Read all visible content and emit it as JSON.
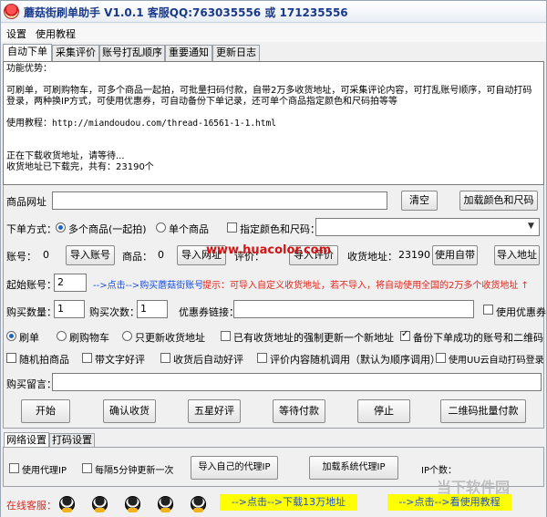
{
  "window": {
    "title": "蘑菇街刷单助手 V1.0.1 客服QQ:763035556 或 171235556"
  },
  "menu": [
    "设置",
    "使用教程"
  ],
  "tabs": [
    "自动下单",
    "采集评价",
    "账号打乱顺序",
    "重要通知",
    "更新日志"
  ],
  "log": {
    "line1": "功能优势：",
    "line2": "可刷单，可刷购物车，可多个商品一起拍，可批量扫码付款，自带2万多收货地址，可采集评论内容，可打乱账号顺序，可自动打码登录，两种换IP方式，可使用优惠券，可自动备份下单记录，还可单个商品指定颜色和尺码拍等等",
    "line3_label": "使用教程：",
    "line3_url": "http://miandoudou.com/thread-16561-1-1.html",
    "line4": "正在下载收货地址，请等待...",
    "line5": "收货地址已下载完，共有：23190个"
  },
  "product": {
    "label": "商品网址",
    "value": "",
    "clear_btn": "清空",
    "add_color_btn": "加载颜色和尺码"
  },
  "order_mode": {
    "label": "下单方式：",
    "options": [
      "多个商品(一起拍)",
      "单个商品"
    ],
    "selected": 0,
    "spec_label": "指定颜色和尺码：",
    "spec_value": ""
  },
  "counts": {
    "account_label": "账号：",
    "account_count": "0",
    "import_account_btn": "导入账号",
    "goods_label": "商品：",
    "goods_count": "0",
    "import_goods_btn": "导入网址",
    "goods2_label": "评价：",
    "import_review_btn": "导入评价",
    "address_label": "收货地址：",
    "address_count": "23190",
    "builtin_btn": "使用自带",
    "import_address_btn": "导入地址"
  },
  "start_account": {
    "label": "起始账号：",
    "value": "2",
    "link": "-->点击-->购买蘑菇街账号",
    "hint": "提示：可导入自定义收货地址，若不导入，将自动使用全国的2万多个收货地址 ↑"
  },
  "purchase": {
    "qty_label": "购买数量：",
    "qty_value": "1",
    "times_label": "购买次数：",
    "times_value": "1",
    "coupon_label": "优惠券链接：",
    "coupon_value": "",
    "use_coupon_label": "使用优惠券"
  },
  "options1": {
    "radio": [
      "刷单",
      "刷购物车",
      "只更新收货地址"
    ],
    "selected": 0,
    "force_addr_label": "已有收货地址的强制更新一个新地址",
    "backup_label": "备份下单成功的账号和二维码"
  },
  "options2": {
    "random_label": "随机拍商品",
    "text_review_label": "带文字好评",
    "auto_review_label": "收货后自动好评",
    "random_review_label": "评价内容随机调用（默认为顺序调用）",
    "uu_label": "使用UU云自动打码登录"
  },
  "message": {
    "label": "购买留言：",
    "value": ""
  },
  "actions": [
    "开始",
    "确认收货",
    "五星好评",
    "等待付款",
    "停止",
    "二维码批量付款"
  ],
  "bottom_tabs": [
    "网络设置",
    "打码设置"
  ],
  "network": {
    "proxy_label": "使用代理IP",
    "refresh_label": "每隔5分钟更新一次",
    "import_proxy_btn": "导入自己的代理IP",
    "load_proxy_btn": "加载系统代理IP",
    "ip_count_label": "IP个数："
  },
  "status": {
    "online_label": "在线客服：",
    "download_link": "-->点击-->下载13万地址",
    "tutorial_link": "-->点击-->看使用教程"
  },
  "watermarks": {
    "site": "www.huacolor.com",
    "corner": "当下软件园"
  },
  "colors": {
    "accent_blue": "#1d4fd8",
    "alert_red": "#e0261d",
    "banner_yellow": "#ffff00"
  }
}
